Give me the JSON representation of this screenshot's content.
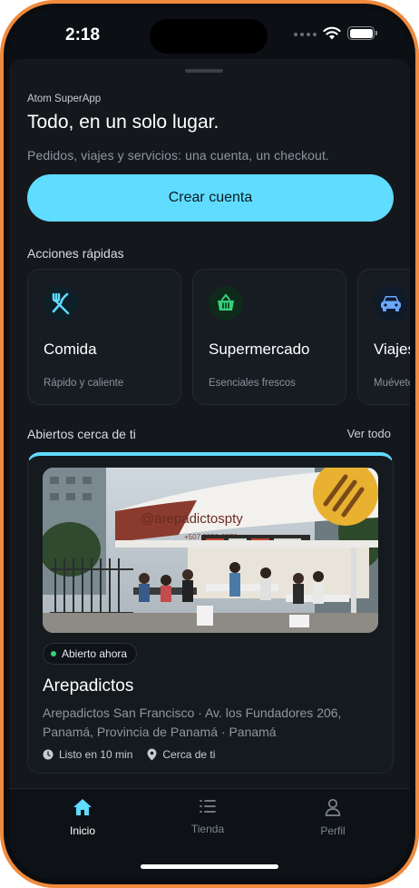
{
  "status_bar": {
    "time": "2:18"
  },
  "header": {
    "eyebrow": "Atom SuperApp",
    "headline": "Todo, en un solo lugar.",
    "subtitle": "Pedidos, viajes y servicios: una cuenta, un checkout."
  },
  "cta": {
    "label": "Crear cuenta"
  },
  "quick_actions": {
    "title": "Acciones rápidas",
    "items": [
      {
        "title": "Comida",
        "subtitle": "Rápido y caliente",
        "icon": "fork-knife-icon"
      },
      {
        "title": "Supermercado",
        "subtitle": "Esenciales frescos",
        "icon": "basket-icon"
      },
      {
        "title": "Viajes",
        "subtitle": "Muévete",
        "icon": "car-icon"
      }
    ]
  },
  "nearby": {
    "title": "Abiertos cerca de ti",
    "see_all": "Ver todo",
    "card": {
      "status": "Abierto ahora",
      "name": "Arepadictos",
      "address": "Arepadictos San Francisco · Av. los Fundadores 206, Panamá, Provincia de Panamá · Panamá",
      "eta": "Listo en 10 min",
      "distance": "Cerca de ti",
      "photo_sign": "@arepadictospty",
      "photo_phone": "+507 6820-8278"
    }
  },
  "tabbar": {
    "tabs": [
      {
        "label": "Inicio",
        "icon": "home-icon",
        "active": true
      },
      {
        "label": "Tienda",
        "icon": "list-icon",
        "active": false
      },
      {
        "label": "Perfil",
        "icon": "person-icon",
        "active": false
      }
    ]
  },
  "colors": {
    "accent": "#5fdcff",
    "background": "#0c0f13",
    "card": "#151a1f",
    "open_dot": "#33d17a",
    "frame": "#f08a3c"
  }
}
